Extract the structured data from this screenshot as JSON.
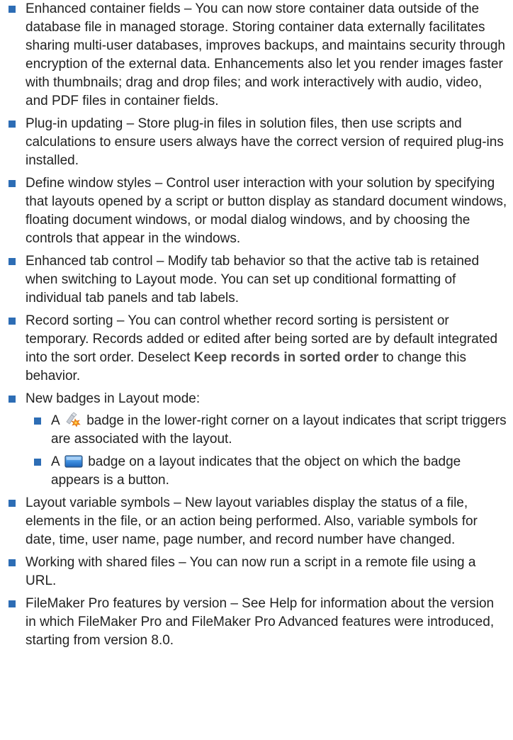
{
  "colors": {
    "bullet": "#2d6db5",
    "text": "#222222"
  },
  "items": [
    {
      "text": "Enhanced container fields – You can now store container data outside of the database file in managed storage. Storing container data externally facilitates sharing multi-user databases, improves backups, and maintains security through encryption of the external data. Enhancements also let you render images faster with thumbnails; drag and drop files; and work interactively with audio, video, and PDF files in container fields."
    },
    {
      "text": "Plug-in updating – Store plug-in files in solution files, then use scripts and calculations to ensure users always have the correct version of required plug-ins installed."
    },
    {
      "text": "Define window styles – Control user interaction with your solution by specifying that layouts opened by a script or button display as standard document windows, floating document windows, or modal dialog windows, and by choosing the controls that appear in the windows."
    },
    {
      "text": "Enhanced tab control – Modify tab behavior so that the active tab is retained when switching to Layout mode. You can set up conditional formatting of individual tab panels and tab labels."
    },
    {
      "text_before": "Record sorting – You can control whether record sorting is persistent or temporary. Records added or edited after being sorted are by default integrated into the sort order. Deselect ",
      "bold": "Keep records in sorted order",
      "text_after": " to change this behavior."
    },
    {
      "text": "New badges in Layout mode:",
      "subitems": [
        {
          "prefix": "A",
          "icon": "script-trigger-badge-icon",
          "suffix": "badge in the lower-right corner on a layout indicates that script triggers are associated with the layout."
        },
        {
          "prefix": "A",
          "icon": "button-badge-icon",
          "suffix": "badge on a layout indicates that the object on which the badge appears is a button."
        }
      ]
    },
    {
      "text": "Layout variable symbols – New layout variables display the status of a file, elements in the file, or an action being performed. Also, variable symbols for date, time, user name, page number, and record number have changed."
    },
    {
      "text": "Working with shared files – You can now run a script in a remote file using a URL."
    },
    {
      "text": "FileMaker Pro features by version – See Help for information about the version in which FileMaker Pro and FileMaker Pro Advanced features were introduced, starting from version 8.0."
    }
  ]
}
